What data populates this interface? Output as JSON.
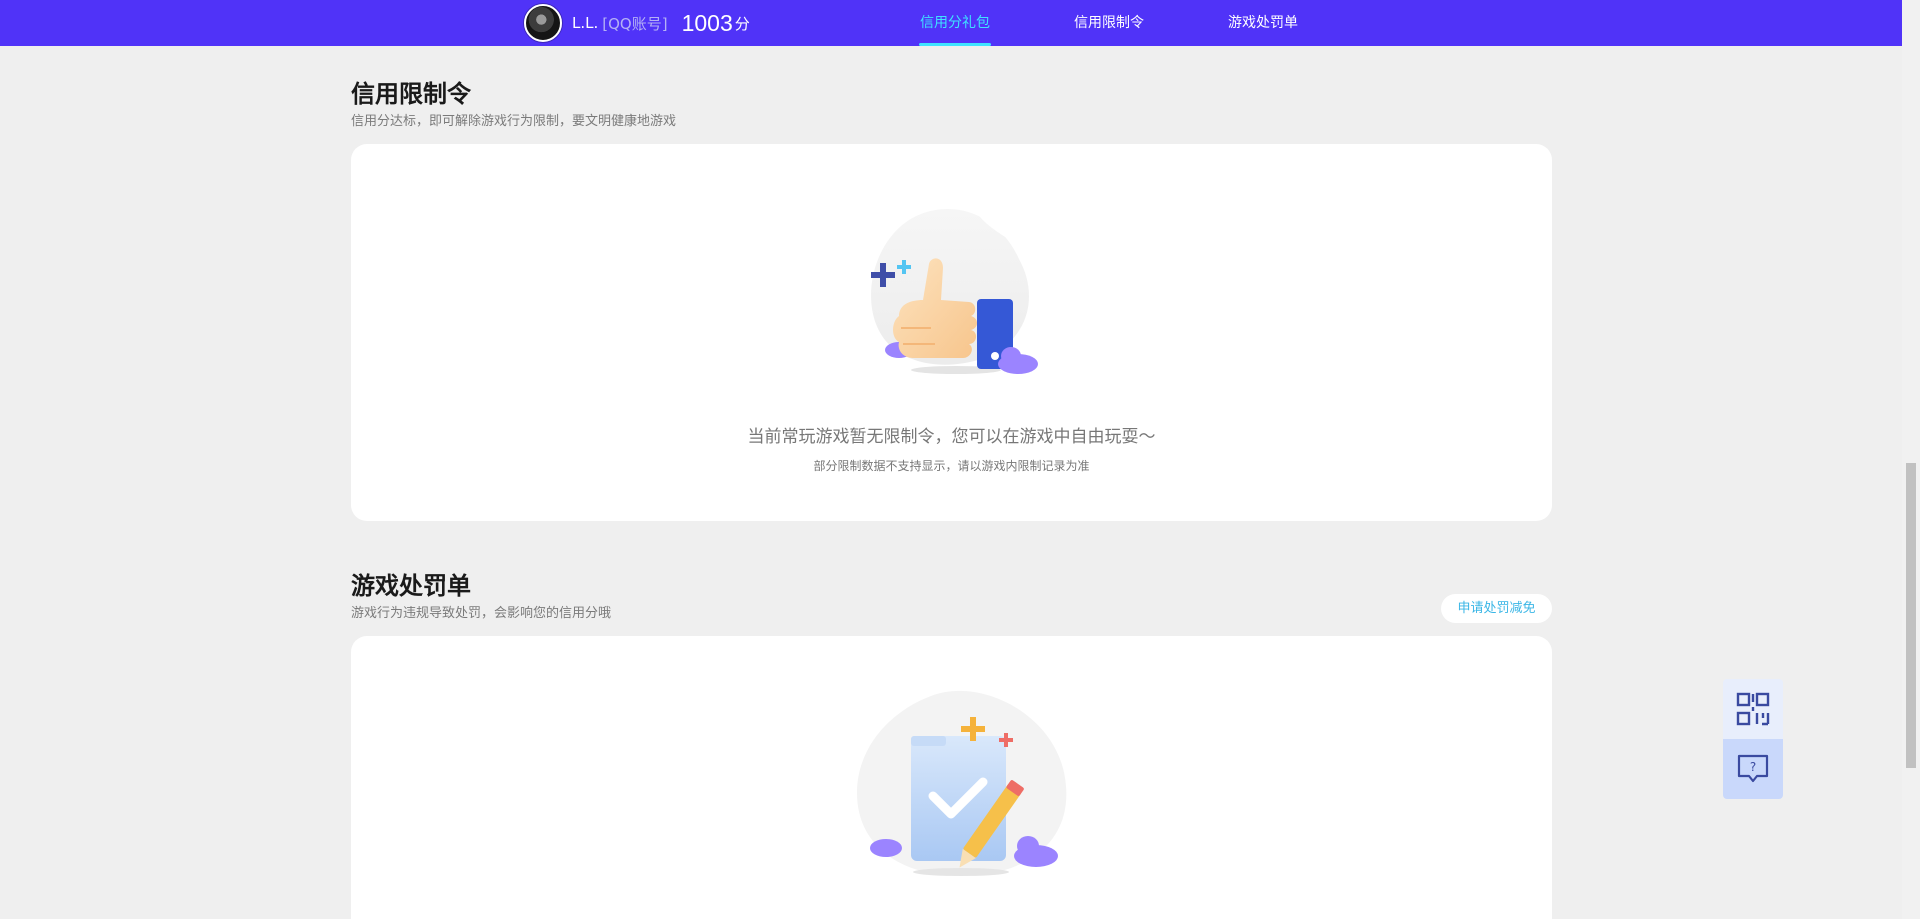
{
  "header": {
    "user_name": "L.L.",
    "account_type": "[QQ账号]",
    "score": "1003",
    "score_unit": "分",
    "nav": [
      {
        "label": "信用分礼包",
        "active": true
      },
      {
        "label": "信用限制令",
        "active": false
      },
      {
        "label": "游戏处罚单",
        "active": false
      }
    ]
  },
  "restriction": {
    "title": "信用限制令",
    "description": "信用分达标，即可解除游戏行为限制，要文明健康地游戏",
    "empty_main": "当前常玩游戏暂无限制令，您可以在游戏中自由玩耍～",
    "empty_sub": "部分限制数据不支持显示，请以游戏内限制记录为准"
  },
  "penalty": {
    "title": "游戏处罚单",
    "description": "游戏行为违规导致处罚，会影响您的信用分哦",
    "appeal_button": "申请处罚减免"
  },
  "floating": {
    "qr_icon": "qr-code-icon",
    "help_icon": "help-chat-icon"
  },
  "colors": {
    "brand": "#5033f8",
    "nav_active": "#3ee3ff",
    "link": "#3ab6e6",
    "background": "#efefef"
  }
}
